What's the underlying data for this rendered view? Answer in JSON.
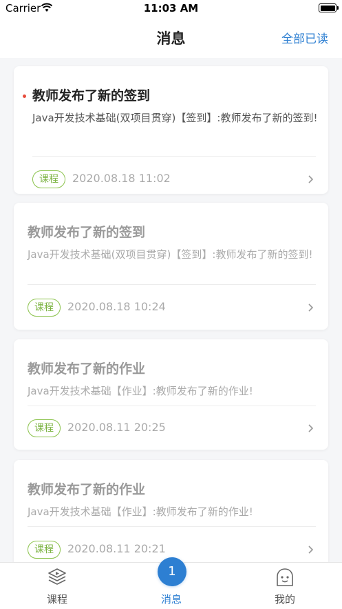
{
  "status_bar": {
    "carrier": "Carrier",
    "time": "11:03 AM"
  },
  "nav": {
    "title": "消息",
    "read_all": "全部已读"
  },
  "messages": [
    {
      "title": "教师发布了新的签到",
      "body": "Java开发技术基础(双项目贯穿)【签到】:教师发布了新的签到!",
      "tag": "课程",
      "time": "2020.08.18 11:02",
      "unread": true
    },
    {
      "title": "教师发布了新的签到",
      "body": "Java开发技术基础(双项目贯穿)【签到】:教师发布了新的签到!",
      "tag": "课程",
      "time": "2020.08.18 10:24",
      "unread": false
    },
    {
      "title": "教师发布了新的作业",
      "body": "Java开发技术基础【作业】:教师发布了新的作业!",
      "tag": "课程",
      "time": "2020.08.11 20:25",
      "unread": false
    },
    {
      "title": "教师发布了新的作业",
      "body": "Java开发技术基础【作业】:教师发布了新的作业!",
      "tag": "课程",
      "time": "2020.08.11 20:21",
      "unread": false
    }
  ],
  "tabbar": {
    "courses": {
      "label": "课程",
      "icon": "course-layers-icon"
    },
    "messages": {
      "label": "消息",
      "badge": "1",
      "icon": "message-badge-icon"
    },
    "mine": {
      "label": "我的",
      "icon": "profile-face-icon"
    }
  },
  "colors": {
    "accent": "#2d7fd2",
    "tag_green": "#7cb342",
    "unread_dot": "#e74c3c"
  }
}
